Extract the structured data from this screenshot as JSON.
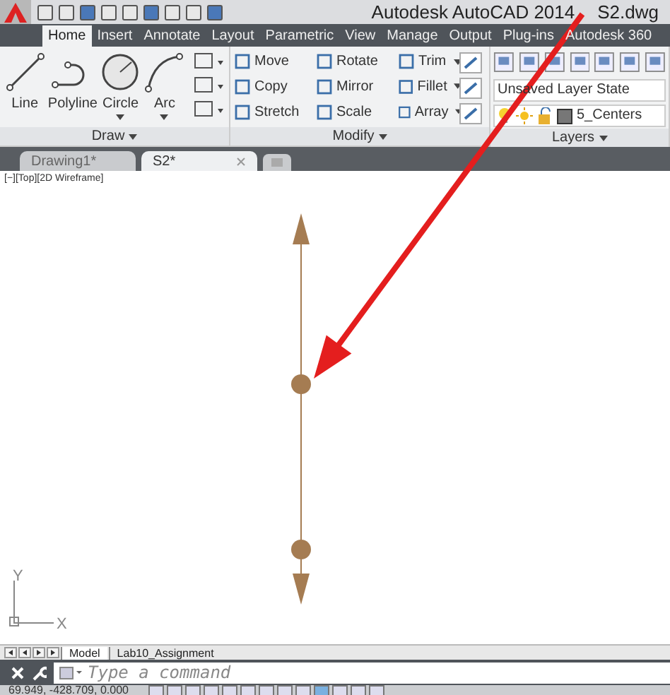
{
  "title_bar": {
    "app_title": "Autodesk AutoCAD 2014",
    "file_name": "S2.dwg"
  },
  "ribbon_tabs": [
    {
      "label": "Home",
      "selected": true
    },
    {
      "label": "Insert",
      "selected": false
    },
    {
      "label": "Annotate",
      "selected": false
    },
    {
      "label": "Layout",
      "selected": false
    },
    {
      "label": "Parametric",
      "selected": false
    },
    {
      "label": "View",
      "selected": false
    },
    {
      "label": "Manage",
      "selected": false
    },
    {
      "label": "Output",
      "selected": false
    },
    {
      "label": "Plug-ins",
      "selected": false
    },
    {
      "label": "Autodesk 360",
      "selected": false
    }
  ],
  "draw_panel": {
    "title": "Draw",
    "tools": [
      {
        "label": "Line",
        "kind": "line",
        "dropdown": false
      },
      {
        "label": "Polyline",
        "kind": "polyline",
        "dropdown": false
      },
      {
        "label": "Circle",
        "kind": "circle",
        "dropdown": true
      },
      {
        "label": "Arc",
        "kind": "arc",
        "dropdown": true
      }
    ]
  },
  "modify_panel": {
    "title": "Modify",
    "tools": [
      {
        "label": "Move",
        "dropdown": false
      },
      {
        "label": "Rotate",
        "dropdown": false
      },
      {
        "label": "Trim",
        "dropdown": true
      },
      {
        "label": "Copy",
        "dropdown": false
      },
      {
        "label": "Mirror",
        "dropdown": false
      },
      {
        "label": "Fillet",
        "dropdown": true
      },
      {
        "label": "Stretch",
        "dropdown": false
      },
      {
        "label": "Scale",
        "dropdown": false
      },
      {
        "label": "Array",
        "dropdown": true
      }
    ]
  },
  "layers_panel": {
    "title": "Layers",
    "layer_state": "Unsaved Layer State",
    "current_layer": "5_Centers"
  },
  "document_tabs": [
    {
      "label": "Drawing1*",
      "selected": false
    },
    {
      "label": "S2*",
      "selected": true
    }
  ],
  "viewport": {
    "label": "[−][Top][2D Wireframe]",
    "ucs_y": "Y",
    "ucs_x": "X"
  },
  "layout_tabs": [
    {
      "label": "Model",
      "selected": true
    },
    {
      "label": "Lab10_Assignment",
      "selected": false
    }
  ],
  "command_line": {
    "placeholder": "Type a command"
  },
  "status_bar": {
    "coordinates": "69.949, -428.709, 0.000"
  }
}
